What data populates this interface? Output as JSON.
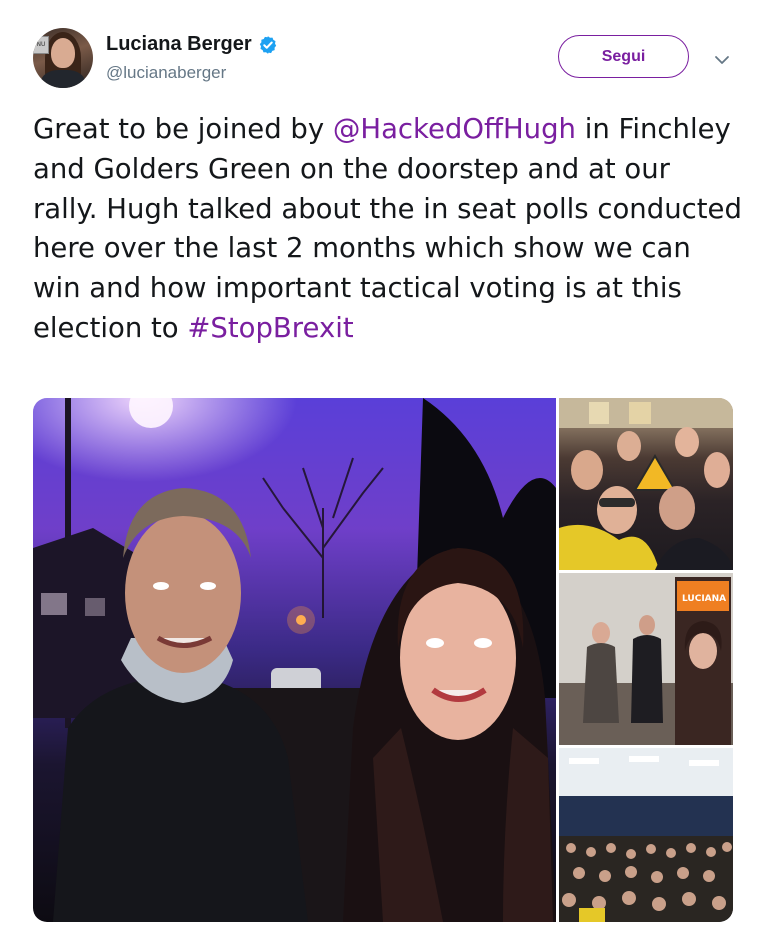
{
  "author": {
    "display_name": "Luciana Berger",
    "handle": "@lucianaberger",
    "verified": true,
    "avatar_sign_text": "NU"
  },
  "actions": {
    "follow_label": "Segui",
    "menu_icon": "chevron-down-icon"
  },
  "tweet": {
    "text_1": "Great to be joined by ",
    "mention": "@HackedOffHugh",
    "text_2": " in Finchley and Golders Green on the doorstep and at our rally. Hugh talked about the in seat polls conducted here over the last 2 months which show we can win and how important tactical voting is at this election to ",
    "hashtag": "#StopBrexit"
  },
  "media": {
    "count": 4,
    "banner_text": "LUCIANA"
  },
  "colors": {
    "accent": "#7a1fa0",
    "text": "#14171a",
    "secondary": "#657786",
    "verified": "#1da1f2"
  }
}
